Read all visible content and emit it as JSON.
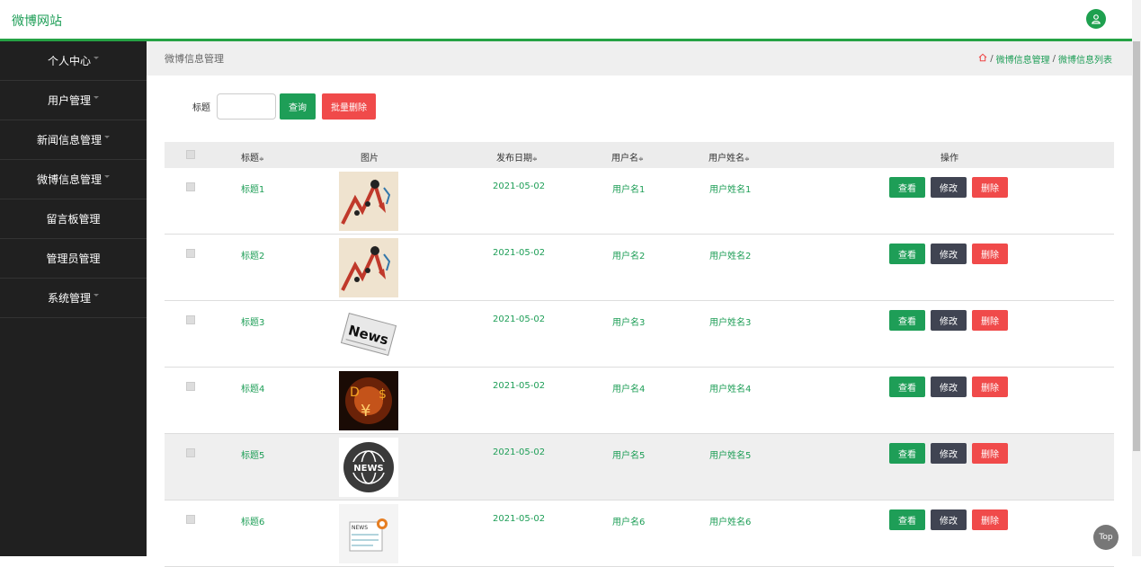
{
  "app": {
    "title": "微博网站"
  },
  "sidebar": {
    "items": [
      {
        "label": "个人中心",
        "caret": true
      },
      {
        "label": "用户管理",
        "caret": true
      },
      {
        "label": "新闻信息管理",
        "caret": true
      },
      {
        "label": "微博信息管理",
        "caret": true
      },
      {
        "label": "留言板管理",
        "caret": false
      },
      {
        "label": "管理员管理",
        "caret": false
      },
      {
        "label": "系统管理",
        "caret": true
      }
    ]
  },
  "page": {
    "title": "微博信息管理",
    "breadcrumb": [
      "微博信息管理",
      "微博信息列表"
    ]
  },
  "search": {
    "label": "标题",
    "value": "",
    "query_label": "查询",
    "batch_delete_label": "批量删除"
  },
  "table": {
    "columns": [
      "标题",
      "图片",
      "发布日期",
      "用户名",
      "用户姓名",
      "操作"
    ],
    "sort_glyph": "≑",
    "rows": [
      {
        "title": "标题1",
        "image": "chart-arrow-image",
        "date": "2021-05-02",
        "username": "用户名1",
        "name": "用户姓名1"
      },
      {
        "title": "标题2",
        "image": "chart-arrow-image",
        "date": "2021-05-02",
        "username": "用户名2",
        "name": "用户姓名2"
      },
      {
        "title": "标题3",
        "image": "news-paper-image",
        "date": "2021-05-02",
        "username": "用户名3",
        "name": "用户姓名3"
      },
      {
        "title": "标题4",
        "image": "currency-fire-image",
        "date": "2021-05-02",
        "username": "用户名4",
        "name": "用户姓名4"
      },
      {
        "title": "标题5",
        "image": "news-globe-image",
        "date": "2021-05-02",
        "username": "用户名5",
        "name": "用户姓名5"
      },
      {
        "title": "标题6",
        "image": "news-document-image",
        "date": "2021-05-02",
        "username": "用户名6",
        "name": "用户姓名6"
      }
    ],
    "actions": {
      "view": "查看",
      "edit": "修改",
      "delete": "删除"
    }
  },
  "top_button": {
    "label": "Top"
  },
  "colors": {
    "accent": "#1e9e57",
    "danger": "#f04a4a",
    "dark": "#404452",
    "sidebar": "#202020"
  }
}
